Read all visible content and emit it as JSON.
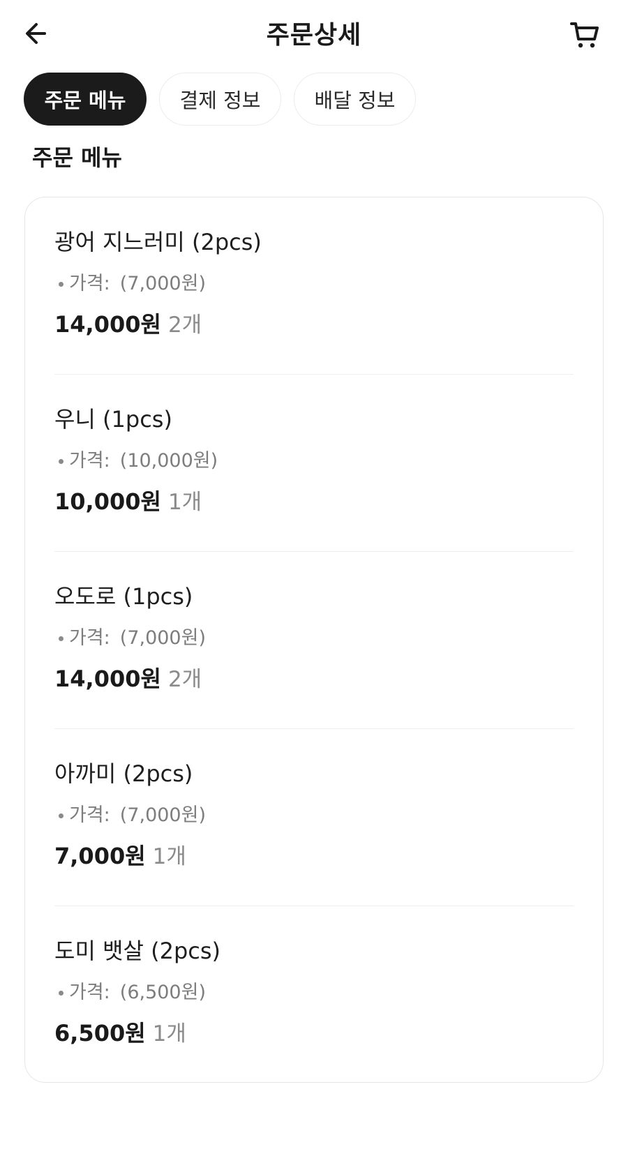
{
  "header": {
    "title": "주문상세",
    "back_icon": "arrow-left-icon",
    "cart_icon": "cart-icon"
  },
  "tabs": [
    {
      "label": "주문 메뉴",
      "active": true
    },
    {
      "label": "결제 정보",
      "active": false
    },
    {
      "label": "배달 정보",
      "active": false
    }
  ],
  "section": {
    "title": "주문 메뉴"
  },
  "items": [
    {
      "name": "광어 지느러미 (2pcs)",
      "price_label": "가격:",
      "unit_price": "(7,000원)",
      "total": "14,000원",
      "qty": "2개"
    },
    {
      "name": "우니 (1pcs)",
      "price_label": "가격:",
      "unit_price": "(10,000원)",
      "total": "10,000원",
      "qty": "1개"
    },
    {
      "name": "오도로 (1pcs)",
      "price_label": "가격:",
      "unit_price": "(7,000원)",
      "total": "14,000원",
      "qty": "2개"
    },
    {
      "name": "아까미 (2pcs)",
      "price_label": "가격:",
      "unit_price": "(7,000원)",
      "total": "7,000원",
      "qty": "1개"
    },
    {
      "name": "도미 뱃살 (2pcs)",
      "price_label": "가격:",
      "unit_price": "(6,500원)",
      "total": "6,500원",
      "qty": "1개"
    }
  ],
  "colors": {
    "active_tab_bg": "#1b1b1b",
    "muted_text": "#7d7d7d",
    "border": "#e6e6e6"
  }
}
